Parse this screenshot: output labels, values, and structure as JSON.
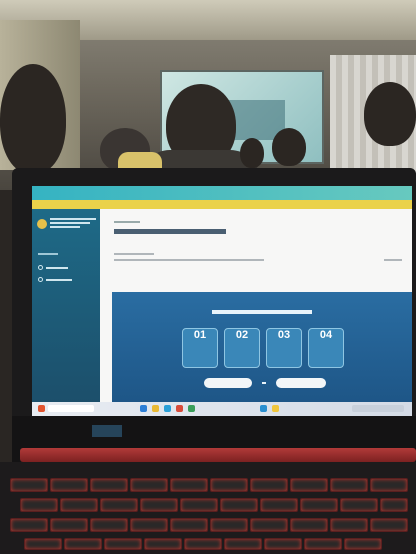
{
  "scene": {
    "description_domain": "photo",
    "colors": {
      "screen_topbar": "#35b3c2",
      "screen_banner": "#ead24a",
      "sidebar": "#1e6a87",
      "hero": "#2a6da2",
      "keyboard_backlight": "#c4382f"
    }
  },
  "app": {
    "sidebar_title": "",
    "breadcrumb": "",
    "page_title": "",
    "hero_title": "",
    "steps": [
      {
        "number": "01",
        "icon": "document-icon"
      },
      {
        "number": "02",
        "icon": "document-icon"
      },
      {
        "number": "03",
        "icon": "document-icon"
      },
      {
        "number": "04",
        "icon": "document-icon"
      }
    ],
    "buttons": [
      {
        "id": "primary"
      },
      {
        "id": "secondary"
      }
    ]
  }
}
